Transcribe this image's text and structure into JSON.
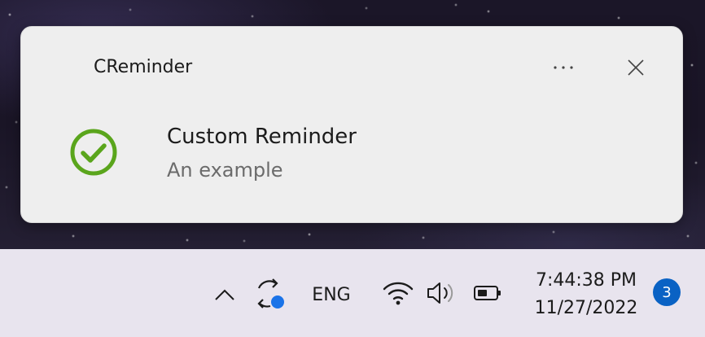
{
  "toast": {
    "app_name": "CReminder",
    "title": "Custom Reminder",
    "body": "An example",
    "icon": "checkmark-circle-icon",
    "more_icon": "more-options-icon",
    "close_icon": "close-icon",
    "accent_color": "#5aa51c"
  },
  "taskbar": {
    "language": "ENG",
    "time": "7:44:38 PM",
    "date": "11/27/2022",
    "notification_count": "3",
    "badge_color": "#0a62c4",
    "sync_dot_color": "#1a73e8",
    "icons": [
      "chevron-up-icon",
      "sync-icon",
      "wifi-icon",
      "volume-icon",
      "battery-icon"
    ]
  }
}
